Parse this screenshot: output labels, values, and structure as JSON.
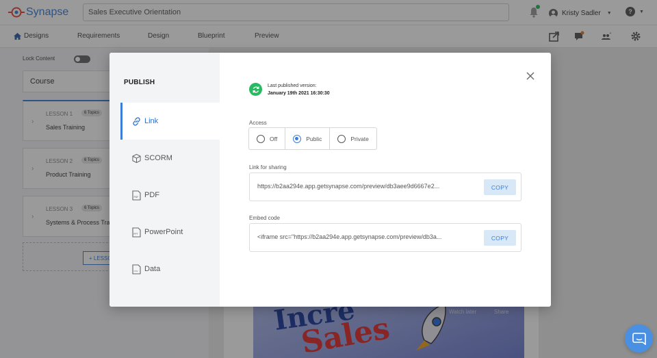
{
  "app": {
    "logo_text": "Synapse",
    "brand_color": "#3b7dd8"
  },
  "header": {
    "title_value": "Sales Executive Orientation",
    "user_name": "Kristy Sadler"
  },
  "nav": {
    "items": [
      {
        "label": "Designs"
      },
      {
        "label": "Requirements"
      },
      {
        "label": "Design"
      },
      {
        "label": "Blueprint"
      },
      {
        "label": "Preview"
      }
    ]
  },
  "sidebar": {
    "lock_label": "Lock Content",
    "course_label": "Course",
    "lessons": [
      {
        "number": "LESSON 1",
        "topics": "6 Topics",
        "name": "Sales Training"
      },
      {
        "number": "LESSON 2",
        "topics": "6 Topics",
        "name": "Product Training"
      },
      {
        "number": "LESSON 3",
        "topics": "6 Topics",
        "name": "Systems & Process Trai"
      }
    ],
    "add_lesson_label": "+ LESSO"
  },
  "video": {
    "text1": "Incre",
    "text2": "Sales",
    "watch_later": "Watch later",
    "share": "Share"
  },
  "modal": {
    "title": "PUBLISH",
    "tabs": [
      {
        "label": "Link",
        "icon": "link-icon"
      },
      {
        "label": "SCORM",
        "icon": "package-icon"
      },
      {
        "label": "PDF",
        "icon": "pdf-file-icon"
      },
      {
        "label": "PowerPoint",
        "icon": "ppt-file-icon"
      },
      {
        "label": "Data",
        "icon": "data-file-icon"
      }
    ],
    "status": {
      "label": "Last published version:",
      "datetime": "January 19th 2021 16:30:30"
    },
    "access": {
      "label": "Access",
      "options": [
        "Off",
        "Public",
        "Private"
      ],
      "selected": "Public"
    },
    "share_link": {
      "label": "Link for sharing",
      "value": "https://b2aa294e.app.getsynapse.com/preview/db3aee9d6667e2...",
      "button": "COPY"
    },
    "embed": {
      "label": "Embed code",
      "value": "<iframe src=\"https://b2aa294e.app.getsynapse.com/preview/db3a...",
      "button": "COPY"
    }
  }
}
